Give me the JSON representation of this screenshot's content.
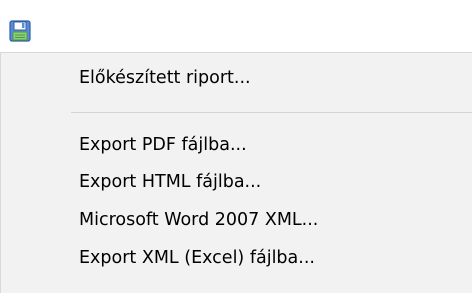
{
  "toolbar": {
    "save_icon": "floppy-disk-icon"
  },
  "menu": {
    "items": [
      {
        "label": "Előkészített riport..."
      },
      {
        "label": "Export PDF fájlba..."
      },
      {
        "label": "Export HTML fájlba..."
      },
      {
        "label": "Microsoft Word 2007 XML..."
      },
      {
        "label": "Export XML (Excel) fájlba..."
      }
    ]
  },
  "colors": {
    "icon_blue": "#3a6fc4",
    "icon_green": "#7cc26a",
    "menu_bg": "#f2f2f2"
  }
}
